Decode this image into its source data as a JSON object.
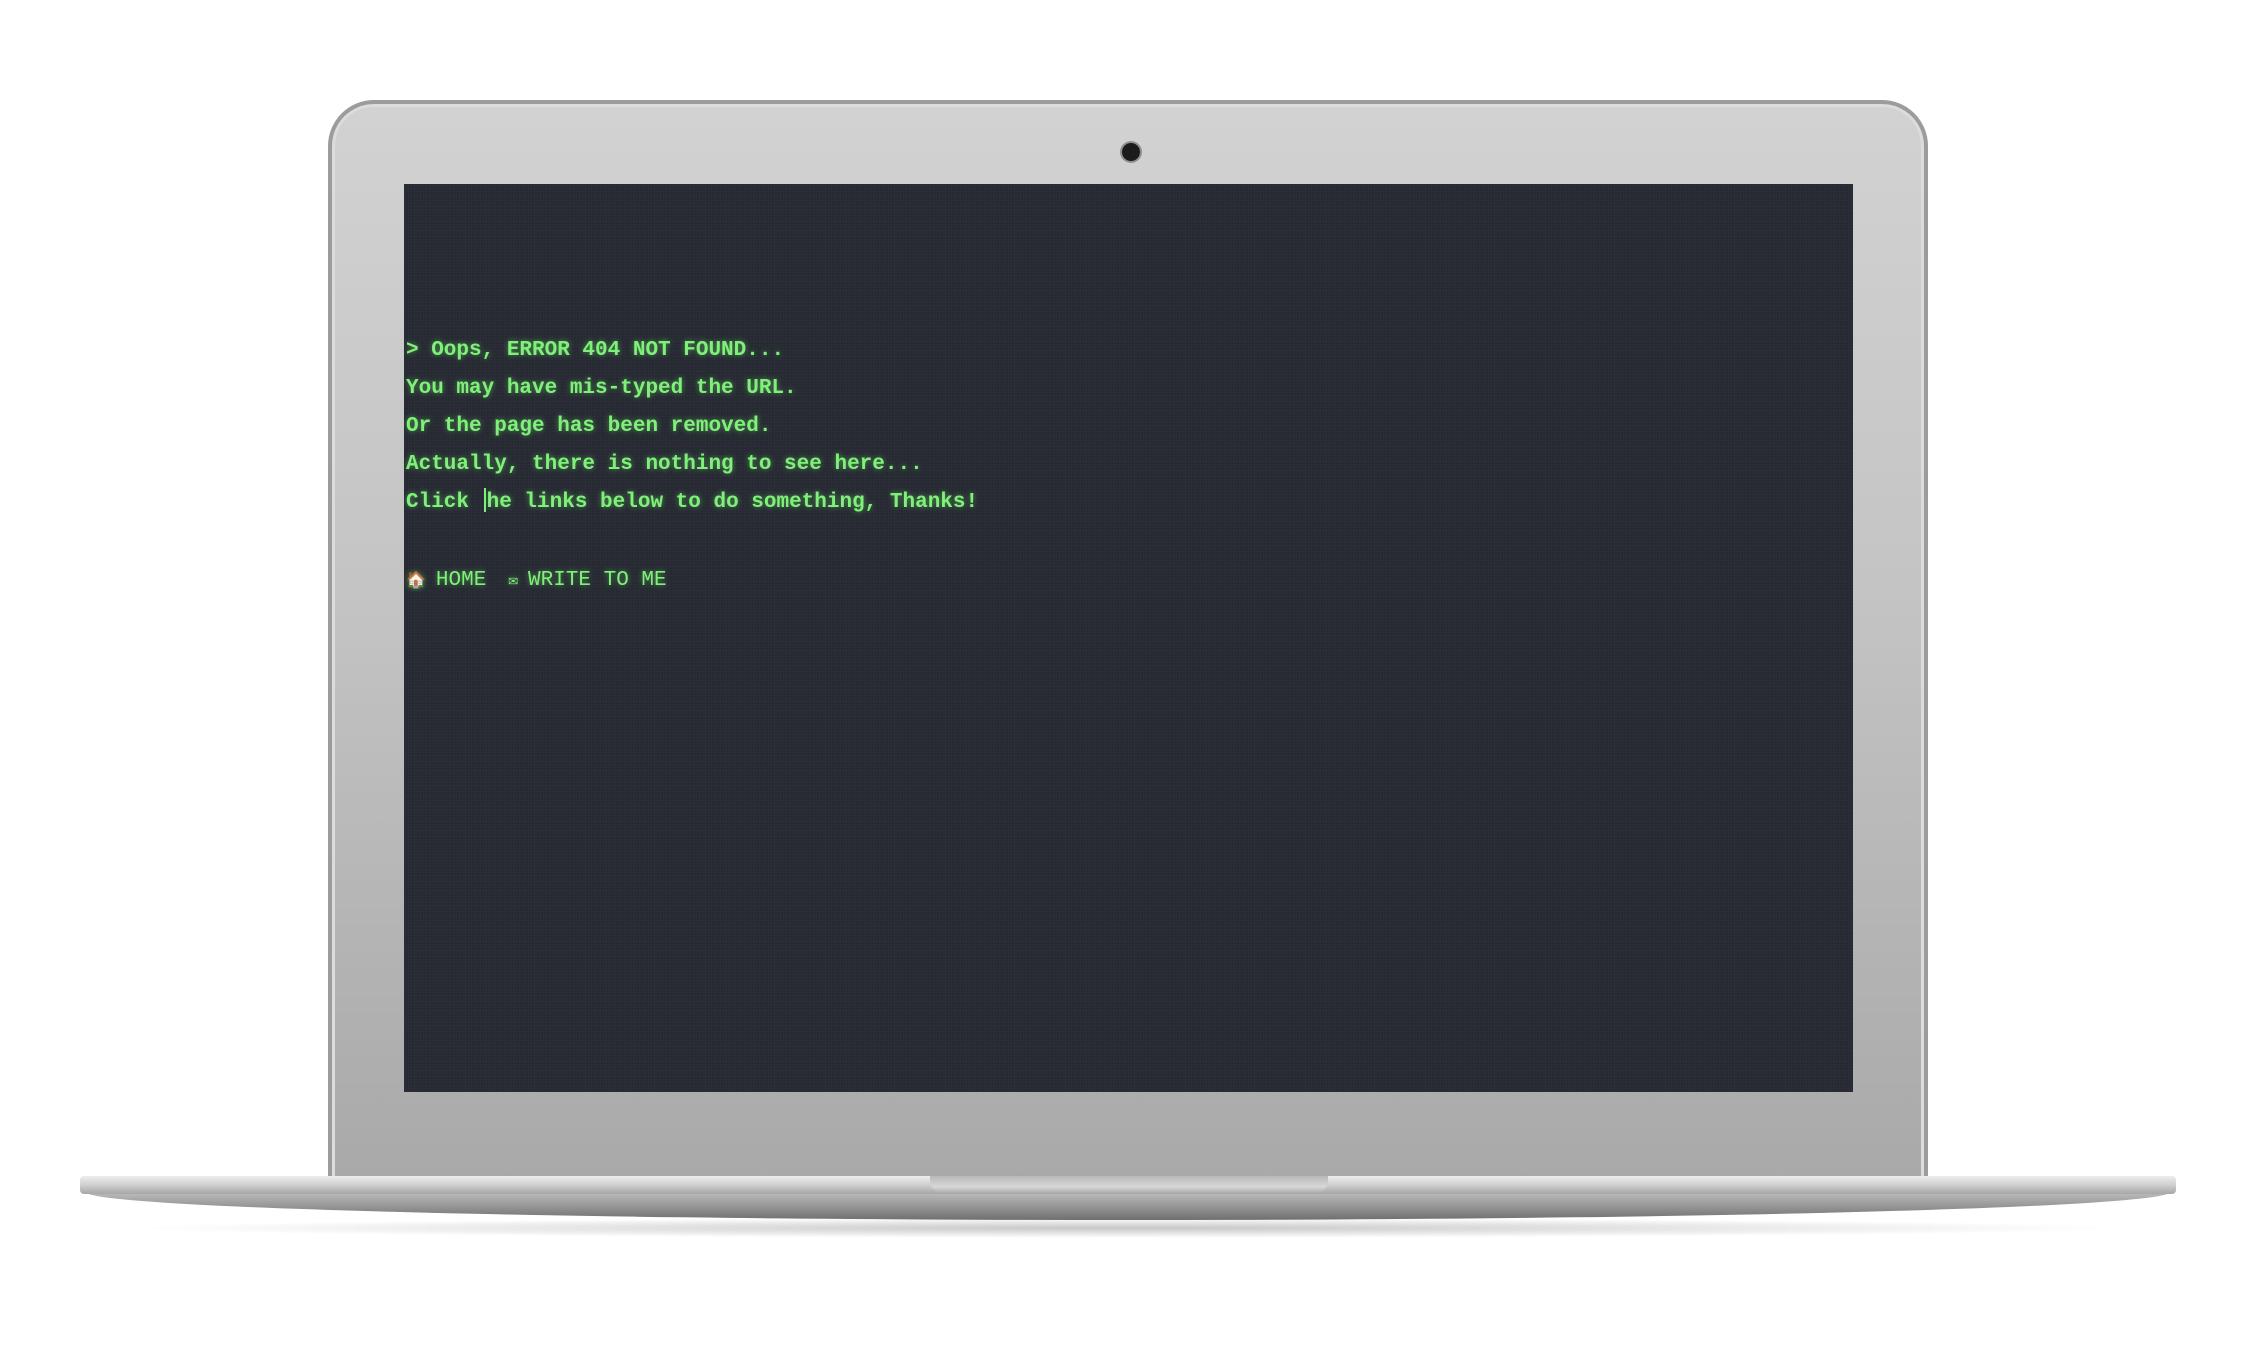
{
  "terminal": {
    "lines": [
      "> Oops, ERROR 404 NOT FOUND...",
      "You may have mis-typed the URL.",
      "Or the page has been removed.",
      "Actually, there is nothing to see here...",
      "Click ",
      "he links below to do something, Thanks!"
    ],
    "text_color": "#7ff07a"
  },
  "links": {
    "home_label": "HOME",
    "home_icon": "🏠",
    "write_label": "WRITE TO ME",
    "write_icon": "✉"
  },
  "colors": {
    "screen_bg": "#272a33",
    "accent_green": "#7ff07a",
    "laptop_silver": "#c4c4c4"
  }
}
